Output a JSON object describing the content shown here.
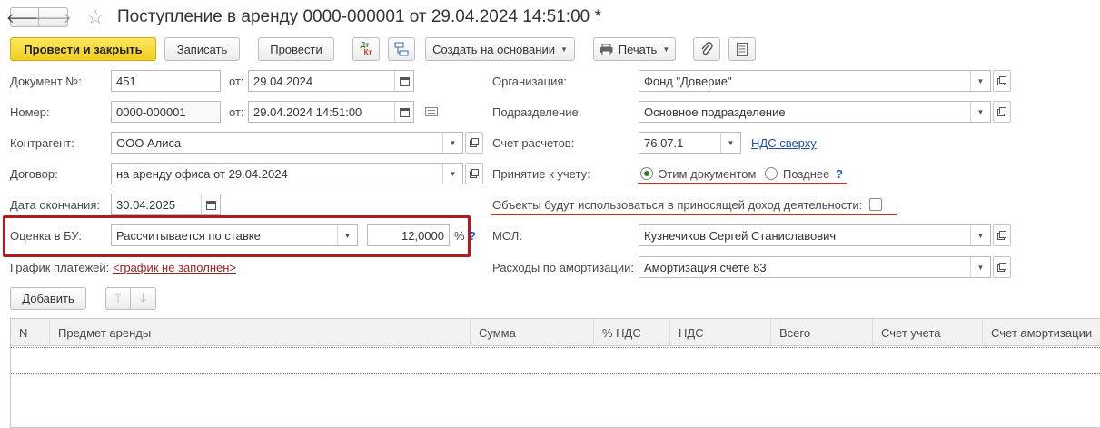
{
  "header": {
    "title": "Поступление в аренду 0000-000001 от 29.04.2024 14:51:00 *",
    "back_glyph": "🡐",
    "forward_glyph": "🡒",
    "star_glyph": "☆"
  },
  "toolbar": {
    "post_close": "Провести и закрыть",
    "save": "Записать",
    "post": "Провести",
    "create_based": "Создать на основании",
    "print": "Печать",
    "dtkt_top": "Дт",
    "dtkt_bottom": "Кт"
  },
  "left": {
    "doc_no_label": "Документ №:",
    "doc_no_value": "451",
    "from_label": "от:",
    "doc_date": "29.04.2024",
    "number_label": "Номер:",
    "number_value": "0000-000001",
    "from_label2": "от:",
    "number_date": "29.04.2024 14:51:00",
    "counterparty_label": "Контрагент:",
    "counterparty_value": "ООО Алиса",
    "contract_label": "Договор:",
    "contract_value": "на аренду офиса от 29.04.2024",
    "end_date_label": "Дата окончания:",
    "end_date_value": "30.04.2025",
    "valuation_label": "Оценка в БУ:",
    "valuation_value": "Рассчитывается по ставке",
    "rate_value": "12,0000",
    "percent": "%",
    "help": "?",
    "schedule_label": "График платежей:",
    "schedule_link": "<график не заполнен>"
  },
  "right": {
    "org_label": "Организация:",
    "org_value": "Фонд \"Доверие\"",
    "dept_label": "Подразделение:",
    "dept_value": "Основное подразделение",
    "account_label": "Счет расчетов:",
    "account_value": "76.07.1",
    "vat_link": "НДС сверху",
    "acceptance_label": "Принятие к учету:",
    "radio_this": "Этим документом",
    "radio_later": "Позднее",
    "help": "?",
    "objects_label": "Объекты будут использоваться в приносящей доход деятельности:",
    "mol_label": "МОЛ:",
    "mol_value": "Кузнечиков Сергей Станиславович",
    "amort_label": "Расходы по амортизации:",
    "amort_value": "Амортизация счете 83"
  },
  "table_toolbar": {
    "add": "Добавить"
  },
  "table": {
    "columns": [
      "N",
      "Предмет аренды",
      "Сумма",
      "% НДС",
      "НДС",
      "Всего",
      "Счет учета",
      "Счет амортизации"
    ],
    "rows": []
  },
  "colors": {
    "primary_button": "#f1cd1e",
    "highlight_box": "#b01c1c",
    "underline": "#b03a2e",
    "link": "#1f4e9e"
  }
}
